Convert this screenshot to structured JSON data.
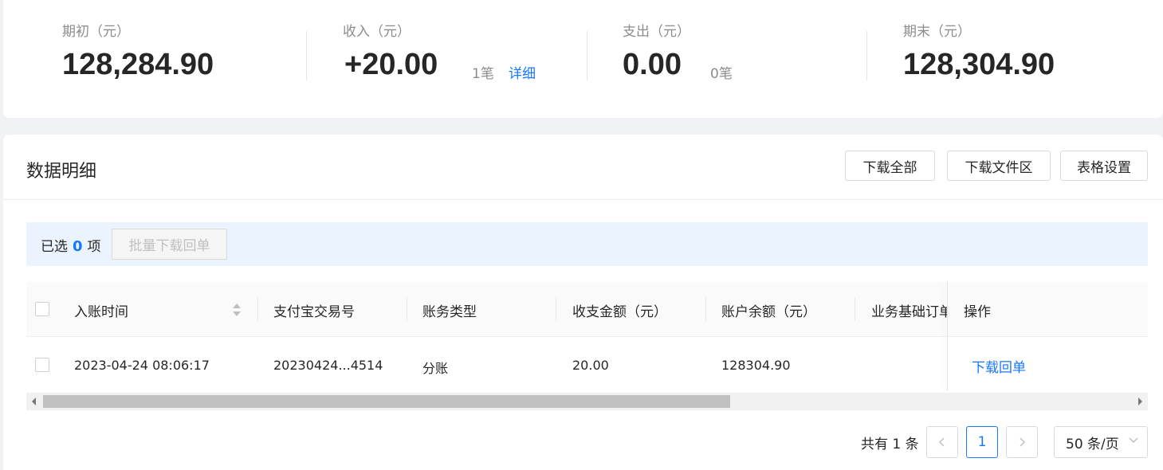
{
  "summary": {
    "opening": {
      "label": "期初（元）",
      "value": "128,284.90"
    },
    "income": {
      "label": "收入（元）",
      "value": "+20.00",
      "count": "1笔",
      "detail_link": "详细"
    },
    "expense": {
      "label": "支出（元）",
      "value": "0.00",
      "count": "0笔"
    },
    "closing": {
      "label": "期末（元）",
      "value": "128,304.90"
    }
  },
  "details": {
    "title": "数据明细",
    "buttons": {
      "download_all": "下载全部",
      "download_area": "下载文件区",
      "table_settings": "表格设置"
    }
  },
  "selection": {
    "prefix": "已选",
    "count": "0",
    "suffix": "项",
    "batch_button": "批量下载回单"
  },
  "table": {
    "columns": [
      "入账时间",
      "支付宝交易号",
      "账务类型",
      "收支金额（元）",
      "账户余额（元）",
      "业务基础订单",
      "操作"
    ],
    "rows": [
      {
        "time": "2023-04-24 08:06:17",
        "trade_no": "20230424...4514",
        "type": "分账",
        "amount": "20.00",
        "balance": "128304.90",
        "order": "",
        "action": "下载回单"
      }
    ]
  },
  "pagination": {
    "total": "共有 1 条",
    "current_page": "1",
    "page_size": "50 条/页"
  }
}
